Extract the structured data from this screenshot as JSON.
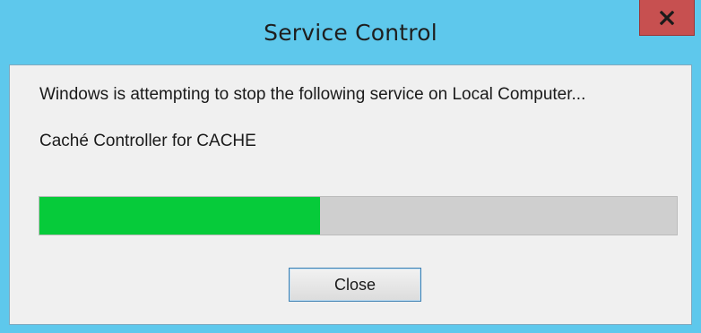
{
  "window": {
    "title": "Service Control",
    "close_icon": "close-icon"
  },
  "dialog": {
    "message": "Windows is attempting to stop the following service on Local Computer...",
    "service_name": "Caché Controller for CACHE",
    "progress": {
      "percent": 44,
      "fill_color": "#06cb3a",
      "track_color": "#cfcfcf"
    },
    "close_button_label": "Close"
  },
  "colors": {
    "titlebar": "#5ec8ec",
    "close_button_bg": "#c75050",
    "client_bg": "#f0f0f0"
  }
}
